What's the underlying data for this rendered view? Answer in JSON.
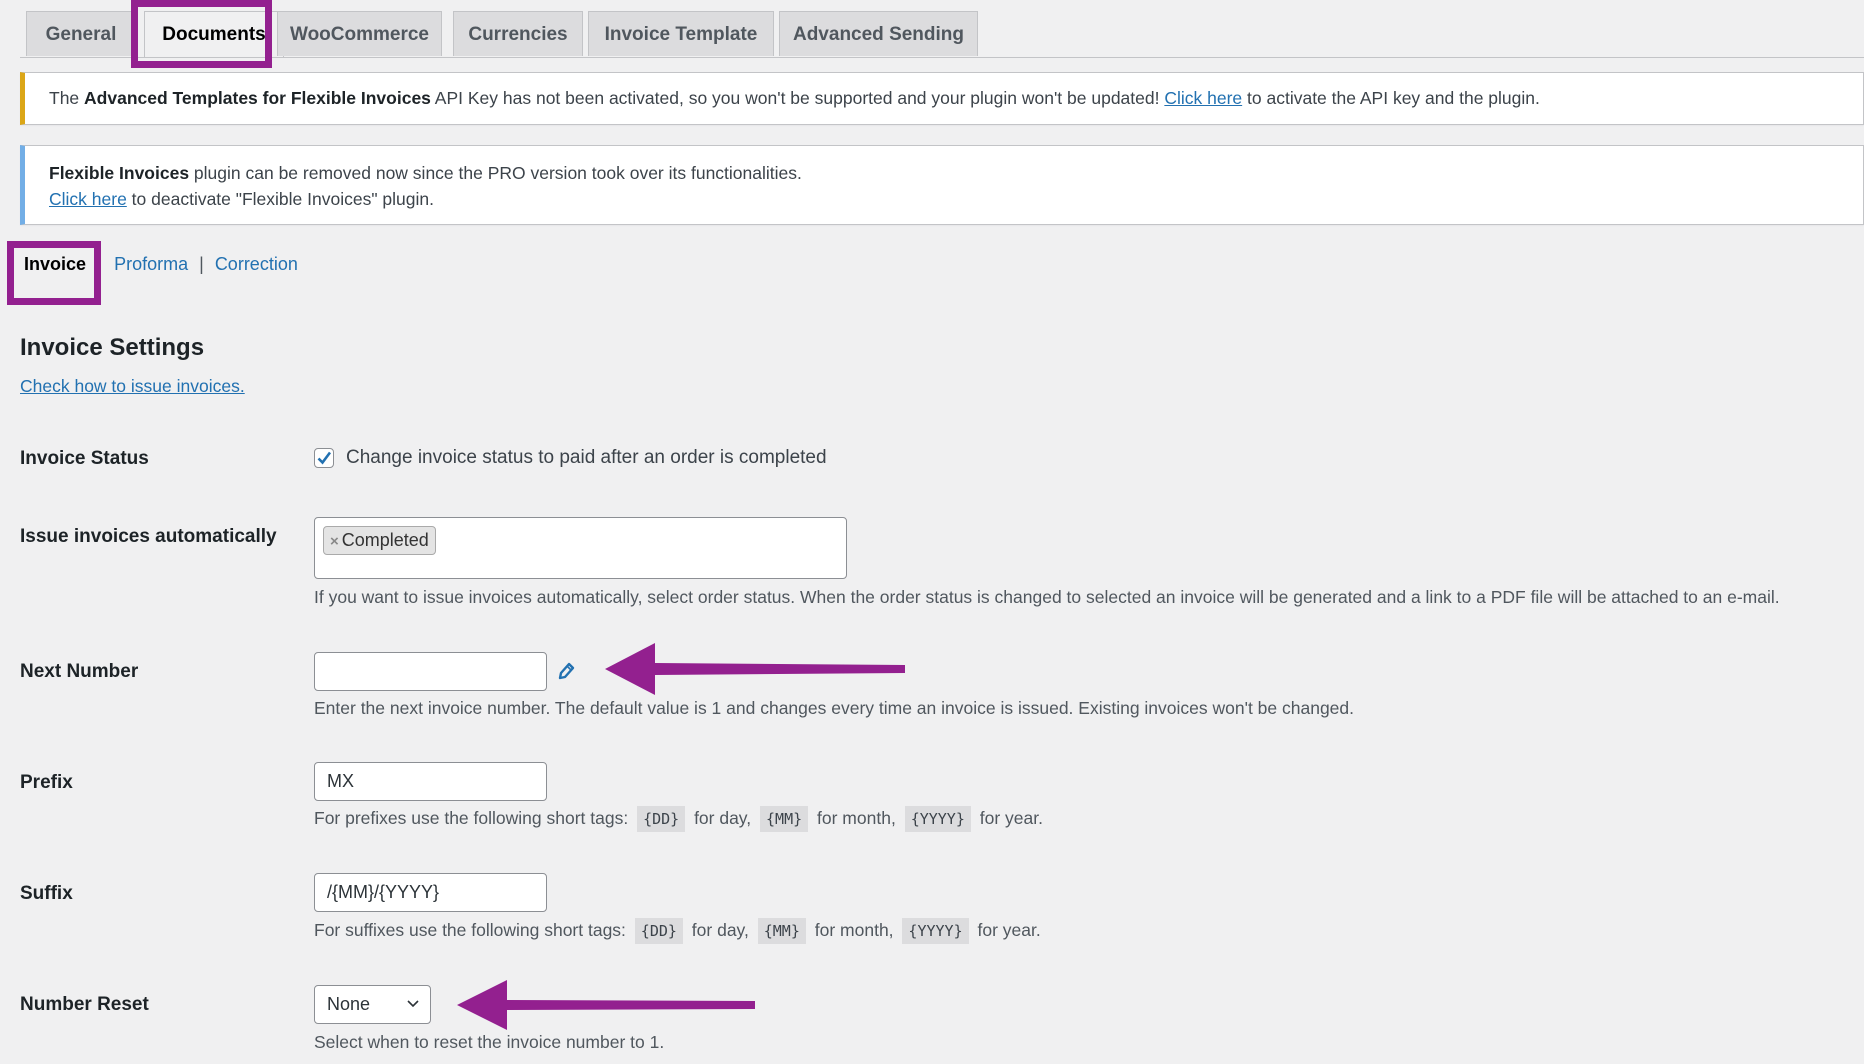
{
  "tabs": [
    {
      "label": "General",
      "active": false
    },
    {
      "label": "Documents",
      "active": true
    },
    {
      "label": "WooCommerce",
      "active": false
    },
    {
      "label": "Currencies",
      "active": false
    },
    {
      "label": "Invoice Template",
      "active": false
    },
    {
      "label": "Advanced Sending",
      "active": false
    }
  ],
  "notices": {
    "api_key": {
      "prefix": "The ",
      "plugin_name": "Advanced Templates for Flexible Invoices",
      "message": " API Key has not been activated, so you won't be supported and your plugin won't be updated! ",
      "link": "Click here",
      "suffix": " to activate the API key and the plugin."
    },
    "removal": {
      "plugin_name": "Flexible Invoices",
      "message": " plugin can be removed now since the PRO version took over its functionalities.",
      "link": "Click here",
      "suffix": " to deactivate \"Flexible Invoices\" plugin."
    }
  },
  "subnav": {
    "items": [
      "Invoice",
      "Proforma",
      "Correction"
    ],
    "separator": "|",
    "current": "Invoice"
  },
  "section": {
    "title": "Invoice Settings",
    "help_link": "Check how to issue invoices."
  },
  "fields": {
    "invoice_status": {
      "label": "Invoice Status",
      "checkbox_label": "Change invoice status to paid after an order is completed",
      "checked": true
    },
    "issue_auto": {
      "label": "Issue invoices automatically",
      "selected": [
        "Completed"
      ],
      "remove_glyph": "×",
      "description": "If you want to issue invoices automatically, select order status. When the order status is changed to selected an invoice will be generated and a link to a PDF file will be attached to an e-mail."
    },
    "next_number": {
      "label": "Next Number",
      "value": "",
      "description": "Enter the next invoice number. The default value is 1 and changes every time an invoice is issued. Existing invoices won't be changed."
    },
    "prefix": {
      "label": "Prefix",
      "value": "MX",
      "desc_start": "For prefixes use the following short tags:",
      "tag_dd": "{DD}",
      "for_day": "for day,",
      "tag_mm": "{MM}",
      "for_month": "for month,",
      "tag_yyyy": "{YYYY}",
      "for_year": "for year."
    },
    "suffix": {
      "label": "Suffix",
      "value": "/{MM}/{YYYY}",
      "desc_start": "For suffixes use the following short tags:",
      "tag_dd": "{DD}",
      "for_day": "for day,",
      "tag_mm": "{MM}",
      "for_month": "for month,",
      "tag_yyyy": "{YYYY}",
      "for_year": "for year."
    },
    "number_reset": {
      "label": "Number Reset",
      "value": "None",
      "description": "Select when to reset the invoice number to 1."
    }
  },
  "colors": {
    "highlight": "#93208f",
    "link": "#2271b1",
    "warning_border": "#dba617",
    "info_border": "#72aee6"
  }
}
